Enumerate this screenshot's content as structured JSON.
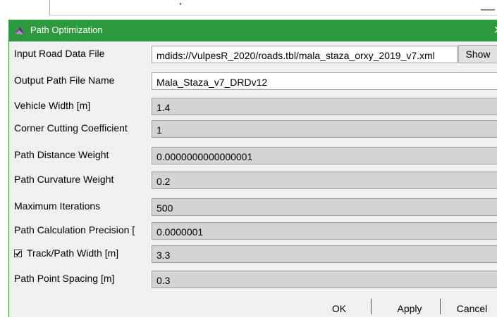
{
  "window": {
    "title": "Path Optimization",
    "close_glyph": "✕"
  },
  "fields": [
    {
      "label": "Input Road Data File",
      "value": "mdids://VulpesR_2020/roads.tbl/mala_staza_orxy_2019_v7.xml",
      "editable": true
    },
    {
      "label": "Output Path File Name",
      "value": "Mala_Staza_v7_DRDv12",
      "editable": true
    },
    {
      "label": "Vehicle Width [m]",
      "value": "1.4",
      "editable": false
    },
    {
      "label": "Corner Cutting Coefficient",
      "value": "1",
      "editable": false
    },
    {
      "label": "Path Distance Weight",
      "value": "0.0000000000000001",
      "editable": false
    },
    {
      "label": "Path Curvature Weight",
      "value": "0.2",
      "editable": false
    },
    {
      "label": "Maximum Iterations",
      "value": "500",
      "editable": false
    },
    {
      "label": "Path Calculation Precision [",
      "value": "0.0000001",
      "editable": false
    },
    {
      "label": "Track/Path Width [m]",
      "value": "3.3",
      "editable": false,
      "checked": true
    },
    {
      "label": "Path Point Spacing [m]",
      "value": "0.3",
      "editable": false
    }
  ],
  "show_button": "Show",
  "buttons": {
    "ok": "OK",
    "apply": "Apply",
    "cancel": "Cancel"
  },
  "colors": {
    "titlebar": "#2e9a3e",
    "field_disabled": "#d4d4d4",
    "field_enabled": "#ffffff",
    "dialog_bg": "#f0f0f0"
  },
  "icons": {
    "app": "app-icon",
    "close": "close-icon",
    "checkbox": "checkbox-checked-icon"
  }
}
